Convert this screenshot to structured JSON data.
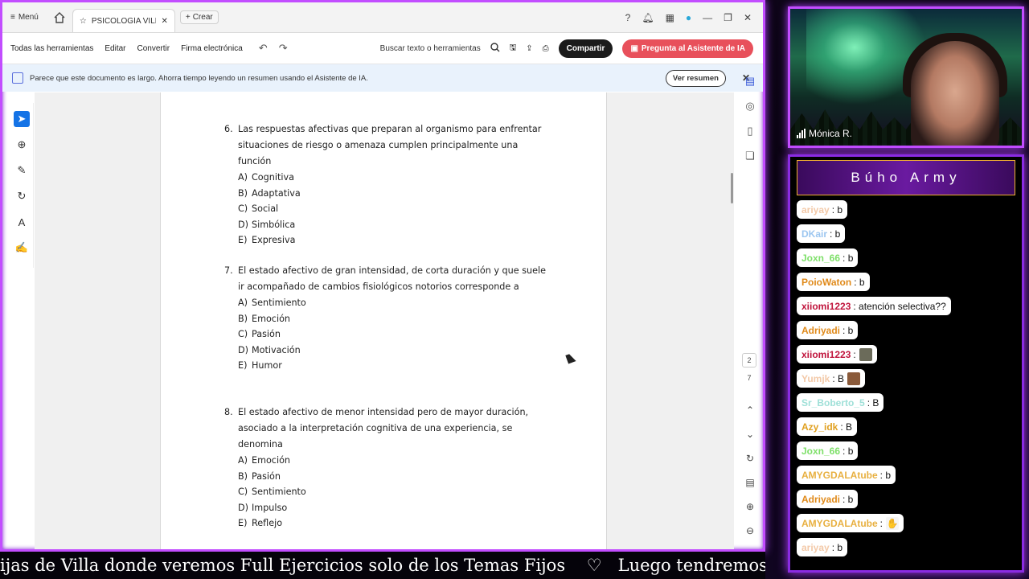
{
  "titlebar": {
    "menu_label": "Menú",
    "tab_title": "PSICOLOGÍA VILLAR...",
    "new_tab_label": "Crear"
  },
  "toolbar": {
    "menus": [
      "Todas las herramientas",
      "Editar",
      "Convertir",
      "Firma electrónica"
    ],
    "search_label": "Buscar texto o herramientas",
    "share_label": "Compartir",
    "ai_label": "Pregunta al Asistente de IA"
  },
  "banner": {
    "text": "Parece que este documento es largo. Ahorra tiempo leyendo un resumen usando el Asistente de IA.",
    "button_label": "Ver resumen"
  },
  "document": {
    "questions": [
      {
        "number": "6.",
        "stem": "Las respuestas afectivas que preparan al organismo para enfrentar situaciones de riesgo o amenaza cumplen principalmente una función",
        "options": [
          {
            "letter": "A)",
            "text": "Cognitiva"
          },
          {
            "letter": "B)",
            "text": "Adaptativa"
          },
          {
            "letter": "C)",
            "text": "Social"
          },
          {
            "letter": "D)",
            "text": "Simbólica"
          },
          {
            "letter": "E)",
            "text": "Expresiva"
          }
        ]
      },
      {
        "number": "7.",
        "stem": "El estado afectivo de gran intensidad, de corta duración y que suele ir acompañado de cambios fisiológicos notorios corresponde a",
        "options": [
          {
            "letter": "A)",
            "text": "Sentimiento"
          },
          {
            "letter": "B)",
            "text": "Emoción"
          },
          {
            "letter": "C)",
            "text": "Pasión"
          },
          {
            "letter": "D)",
            "text": "Motivación"
          },
          {
            "letter": "E)",
            "text": "Humor"
          }
        ]
      },
      {
        "number": "8.",
        "stem": "El estado afectivo de menor intensidad pero de mayor duración, asociado a la interpretación cognitiva de una experiencia, se denomina",
        "options": [
          {
            "letter": "A)",
            "text": "Emoción"
          },
          {
            "letter": "B)",
            "text": "Pasión"
          },
          {
            "letter": "C)",
            "text": "Sentimiento"
          },
          {
            "letter": "D)",
            "text": "Impulso"
          },
          {
            "letter": "E)",
            "text": "Reflejo"
          }
        ]
      }
    ],
    "current_page": "2",
    "total_pages": "7"
  },
  "ticker": {
    "text": "ijas de Villa donde veremos Full Ejercicios solo de los Temas Fijos    ♡   Luego tendremos Las Fij"
  },
  "webcam": {
    "name": "Mónica R."
  },
  "chat": {
    "title": "Búho Army",
    "messages": [
      {
        "user": "ariyay",
        "text": ": b",
        "color": "#f3c9a8"
      },
      {
        "user": "DKair",
        "text": ": b",
        "color": "#9cc6f0"
      },
      {
        "user": "Joxn_66",
        "text": ": b",
        "color": "#7fe06a"
      },
      {
        "user": "PoioWaton",
        "text": ": b",
        "color": "#e08a1a"
      },
      {
        "user": "xiiomi1223",
        "text": ": atención selectiva??",
        "color": "#c0143c"
      },
      {
        "user": "Adriyadi",
        "text": ": b",
        "color": "#e08a1a"
      },
      {
        "user": "xiiomi1223",
        "text": ":",
        "color": "#c0143c",
        "emote": "image-emote"
      },
      {
        "user": "Yumjk",
        "text": ": B",
        "color": "#f3c9a8",
        "emote": "person-emote"
      },
      {
        "user": "Sr_Boberto_5",
        "text": ": B",
        "color": "#9fe0d8"
      },
      {
        "user": "Azy_idk",
        "text": ": B",
        "color": "#e0a020"
      },
      {
        "user": "Joxn_66",
        "text": ": b",
        "color": "#7fe06a"
      },
      {
        "user": "AMYGDALAtube",
        "text": ": b",
        "color": "#e8b040"
      },
      {
        "user": "Adriyadi",
        "text": ": b",
        "color": "#e08a1a"
      },
      {
        "user": "AMYGDALAtube",
        "text": ":",
        "color": "#e8b040",
        "emote": "hand-emote"
      },
      {
        "user": "ariyay",
        "text": ": b",
        "color": "#f3c9a8"
      }
    ]
  }
}
